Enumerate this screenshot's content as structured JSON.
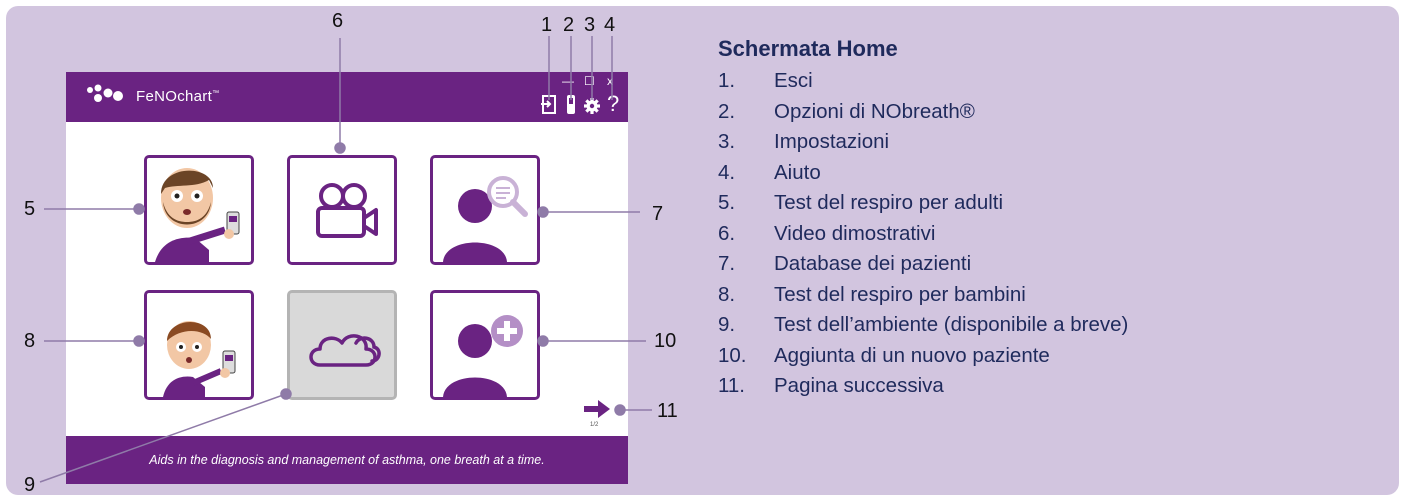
{
  "app": {
    "title": "FeNOchart",
    "trademark": "™",
    "window_controls": {
      "minimize": "—",
      "maximize": "☐",
      "close": "x"
    },
    "help_label": "?",
    "footer_tagline": "Aids in the diagnosis and management of asthma, one breath at a time.",
    "page_indicator": "1/2",
    "tiles": [
      {
        "id": "adult-breath-test",
        "enabled": true
      },
      {
        "id": "demo-videos",
        "enabled": true
      },
      {
        "id": "patient-database",
        "enabled": true
      },
      {
        "id": "child-breath-test",
        "enabled": true
      },
      {
        "id": "ambient-test",
        "enabled": false
      },
      {
        "id": "add-patient",
        "enabled": true
      }
    ],
    "colors": {
      "brand": "#6a2382",
      "panel": "#d2c5df",
      "disabled": "#d9d9d9"
    }
  },
  "callout_numbers": [
    "1",
    "2",
    "3",
    "4",
    "5",
    "6",
    "7",
    "8",
    "9",
    "10",
    "11"
  ],
  "legend": {
    "title": "Schermata Home",
    "items": [
      {
        "num": "1.",
        "label": "Esci"
      },
      {
        "num": "2.",
        "label": "Opzioni di NObreath®"
      },
      {
        "num": "3.",
        "label": "Impostazioni"
      },
      {
        "num": "4.",
        "label": "Aiuto"
      },
      {
        "num": "5.",
        "label": "Test del respiro per adulti"
      },
      {
        "num": "6.",
        "label": "Video dimostrativi"
      },
      {
        "num": "7.",
        "label": "Database dei pazienti"
      },
      {
        "num": "8.",
        "label": "Test del respiro per bambini"
      },
      {
        "num": "9.",
        "label": "Test dell’ambiente (disponibile a breve)"
      },
      {
        "num": "10.",
        "label": "Aggiunta di un nuovo paziente"
      },
      {
        "num": "11.",
        "label": "Pagina successiva"
      }
    ]
  }
}
